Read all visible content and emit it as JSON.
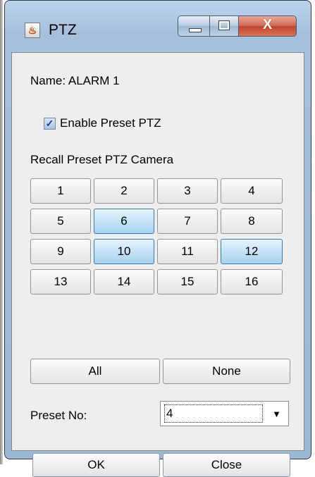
{
  "window": {
    "title": "PTZ",
    "close_symbol": "X"
  },
  "form": {
    "name_label": "Name: ALARM  1",
    "enable_checkbox": {
      "label": "Enable Preset PTZ",
      "checked": true,
      "check_glyph": "✓"
    },
    "recall_label": "Recall Preset PTZ Camera",
    "cameras": [
      {
        "label": "1",
        "selected": false
      },
      {
        "label": "2",
        "selected": false
      },
      {
        "label": "3",
        "selected": false
      },
      {
        "label": "4",
        "selected": false
      },
      {
        "label": "5",
        "selected": false
      },
      {
        "label": "6",
        "selected": true
      },
      {
        "label": "7",
        "selected": false
      },
      {
        "label": "8",
        "selected": false
      },
      {
        "label": "9",
        "selected": false
      },
      {
        "label": "10",
        "selected": true
      },
      {
        "label": "11",
        "selected": false
      },
      {
        "label": "12",
        "selected": true
      },
      {
        "label": "13",
        "selected": false
      },
      {
        "label": "14",
        "selected": false
      },
      {
        "label": "15",
        "selected": false
      },
      {
        "label": "16",
        "selected": false
      }
    ],
    "all_label": "All",
    "none_label": "None",
    "preset_label": "Preset No:",
    "preset_value": "4",
    "preset_arrow": "▼"
  },
  "footer": {
    "ok_label": "OK",
    "close_label": "Close"
  },
  "colors": {
    "selected_button": "#a6d2f0",
    "window_frame": "#9bb7d4",
    "close_button": "#c0442b"
  },
  "icons": [
    "java-app-icon",
    "minimize-icon",
    "maximize-icon",
    "close-icon",
    "checkmark-icon",
    "dropdown-arrow-icon"
  ]
}
